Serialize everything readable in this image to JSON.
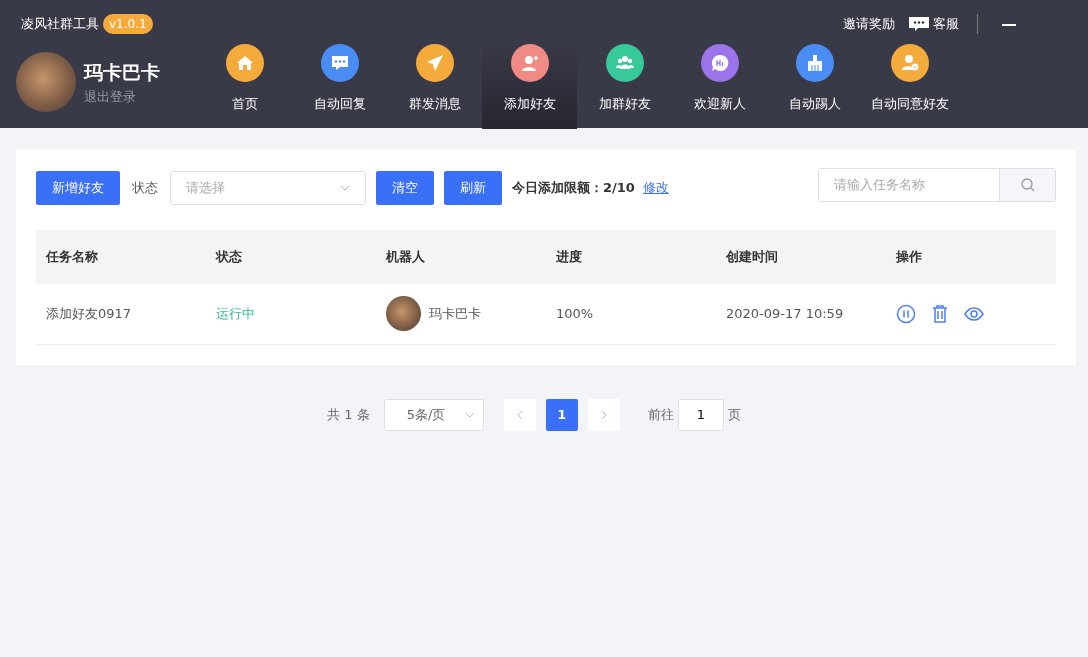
{
  "app": {
    "title": "凌风社群工具",
    "version": "v1.0.1"
  },
  "header_links": [
    {
      "kind": "text",
      "label": "邀请奖励"
    },
    {
      "kind": "chat",
      "label": "客服"
    }
  ],
  "user": {
    "name": "玛卡巴卡",
    "logout": "退出登录"
  },
  "nav": [
    {
      "label": "首页",
      "color": "#f5ab3c",
      "selected": false
    },
    {
      "label": "自动回复",
      "color": "#4a8ef5",
      "selected": false
    },
    {
      "label": "群发消息",
      "color": "#f5ab3c",
      "selected": false
    },
    {
      "label": "添加好友",
      "color": "#f08a85",
      "selected": true
    },
    {
      "label": "加群好友",
      "color": "#38c99a",
      "selected": false
    },
    {
      "label": "欢迎新人",
      "color": "#9a74e8",
      "selected": false
    },
    {
      "label": "自动踢人",
      "color": "#4a8ef5",
      "selected": false
    },
    {
      "label": "自动同意好友",
      "color": "#f5ab3c",
      "selected": false
    }
  ],
  "toolbar": {
    "add_button": "新增好友",
    "status_label": "状态",
    "status_select": {
      "placeholder": "请选择"
    },
    "clear_button": "清空",
    "refresh_button": "刷新",
    "limit_label": "今日添加限额：",
    "limit_value": "2/10",
    "edit_link": "修改",
    "search": {
      "placeholder": "请输入任务名称"
    }
  },
  "table": {
    "columns": [
      "任务名称",
      "状态",
      "机器人",
      "进度",
      "创建时间",
      "操作"
    ],
    "rows": [
      {
        "task": "添加好友0917",
        "status": "运行中",
        "robot": "玛卡巴卡",
        "progress": "100%",
        "created": "2020-09-17 10:59"
      }
    ]
  },
  "pagination": {
    "total": "共 1 条",
    "page_size": "5条/页",
    "pages": [
      {
        "label": "1",
        "selected": true
      }
    ],
    "goto_label": "前往",
    "goto_value": "1",
    "page_suffix": "页"
  }
}
